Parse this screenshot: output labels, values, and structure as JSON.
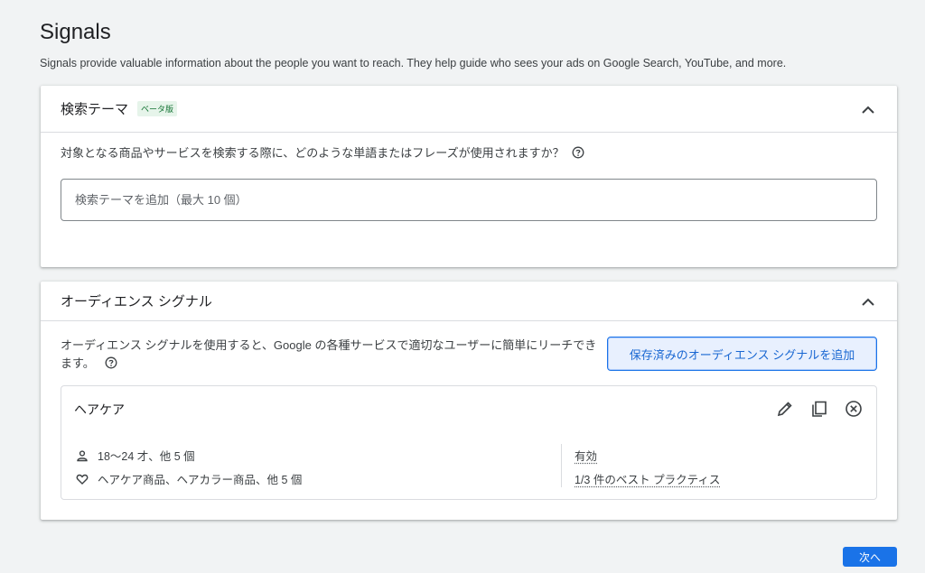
{
  "page": {
    "title": "Signals",
    "subtitle": "Signals provide valuable information about the people you want to reach. They help guide who sees your ads on Google Search, YouTube, and more."
  },
  "search_themes": {
    "title": "検索テーマ",
    "badge": "ベータ版",
    "question": "対象となる商品やサービスを検索する際に、どのような単語またはフレーズが使用されますか？",
    "input_placeholder": "検索テーマを追加（最大 10 個）",
    "input_value": ""
  },
  "audience_signal": {
    "title": "オーディエンス シグナル",
    "description": "オーディエンス シグナルを使用すると、Google の各種サービスで適切なユーザーに簡単にリーチできます。",
    "add_button_label": "保存済みのオーディエンス シグナルを追加",
    "signal": {
      "name": "ヘアケア",
      "demographics": "18〜24 才、他 5 個",
      "interests": "ヘアケア商品、ヘアカラー商品、他 5 個",
      "status": "有効",
      "best_practices": "1/3 件のベスト プラクティス"
    }
  },
  "footer": {
    "next_label": "次へ"
  },
  "icons": {
    "collapse": "chevron-up-icon",
    "help": "help-icon",
    "edit": "pencil-icon",
    "copy": "copy-icon",
    "remove": "remove-circle-icon",
    "person": "person-icon",
    "heart": "heart-icon"
  },
  "colors": {
    "accent": "#1a73e8",
    "badge_bg": "#e6f4ea",
    "badge_text": "#137333",
    "background": "#f1f3f4"
  }
}
